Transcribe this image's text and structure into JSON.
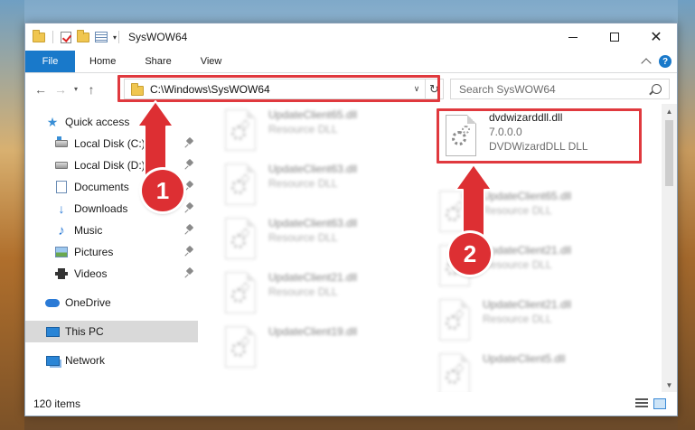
{
  "window": {
    "title": "SysWOW64",
    "controls": {
      "minimize": "—",
      "maximize": "□",
      "close": "✕"
    }
  },
  "ribbon": {
    "tabs": [
      "File",
      "Home",
      "Share",
      "View"
    ],
    "help": "?"
  },
  "navbar": {
    "back": "←",
    "forward": "→",
    "recent": "▾",
    "up": "↑",
    "address": "C:\\Windows\\SysWOW64",
    "address_dropdown": "∨",
    "refresh": "↻",
    "search_placeholder": "Search SysWOW64"
  },
  "sidebar": {
    "items": [
      {
        "label": "Quick access",
        "icon": "star-icon",
        "pinned": false
      },
      {
        "label": "Local Disk (C:)",
        "icon": "drive-c-icon",
        "pinned": true
      },
      {
        "label": "Local Disk (D:)",
        "icon": "drive-d-icon",
        "pinned": true
      },
      {
        "label": "Documents",
        "icon": "documents-icon",
        "pinned": true
      },
      {
        "label": "Downloads",
        "icon": "downloads-icon",
        "pinned": true
      },
      {
        "label": "Music",
        "icon": "music-icon",
        "pinned": true
      },
      {
        "label": "Pictures",
        "icon": "pictures-icon",
        "pinned": true
      },
      {
        "label": "Videos",
        "icon": "videos-icon",
        "pinned": true
      },
      {
        "label": "OneDrive",
        "icon": "onedrive-icon",
        "pinned": false
      },
      {
        "label": "This PC",
        "icon": "this-pc-icon",
        "pinned": false,
        "selected": true
      },
      {
        "label": "Network",
        "icon": "network-icon",
        "pinned": false
      }
    ]
  },
  "files": {
    "highlighted": {
      "name": "dvdwizarddll.dll",
      "version": "7.0.0.0",
      "description": "DVDWizardDLL DLL"
    },
    "left_column": [
      {
        "name": "UpdateClient65.dll",
        "type": "Resource DLL"
      },
      {
        "name": "UpdateClient63.dll",
        "type": "Resource DLL"
      },
      {
        "name": "UpdateClient63.dll",
        "type": "Resource DLL"
      },
      {
        "name": "UpdateClient21.dll",
        "type": "Resource DLL"
      },
      {
        "name": "UpdateClient19.dll",
        "type": "Resource DLL"
      }
    ],
    "right_column": [
      {
        "name": "UpdateClient65.dll",
        "type": "Resource DLL"
      },
      {
        "name": "UpdateClient21.dll",
        "type": "Resource DLL"
      },
      {
        "name": "UpdateClient21.dll",
        "type": "Resource DLL"
      },
      {
        "name": "UpdateClient5.dll",
        "type": "Resource DLL"
      }
    ]
  },
  "status": {
    "item_count": "120 items"
  },
  "annotations": {
    "step1": "1",
    "step2": "2",
    "highlight_color": "#e0393e",
    "badge_color": "#dd2f33"
  },
  "colors": {
    "accent": "#1979ca",
    "selected_bg": "#d9d9d9"
  }
}
